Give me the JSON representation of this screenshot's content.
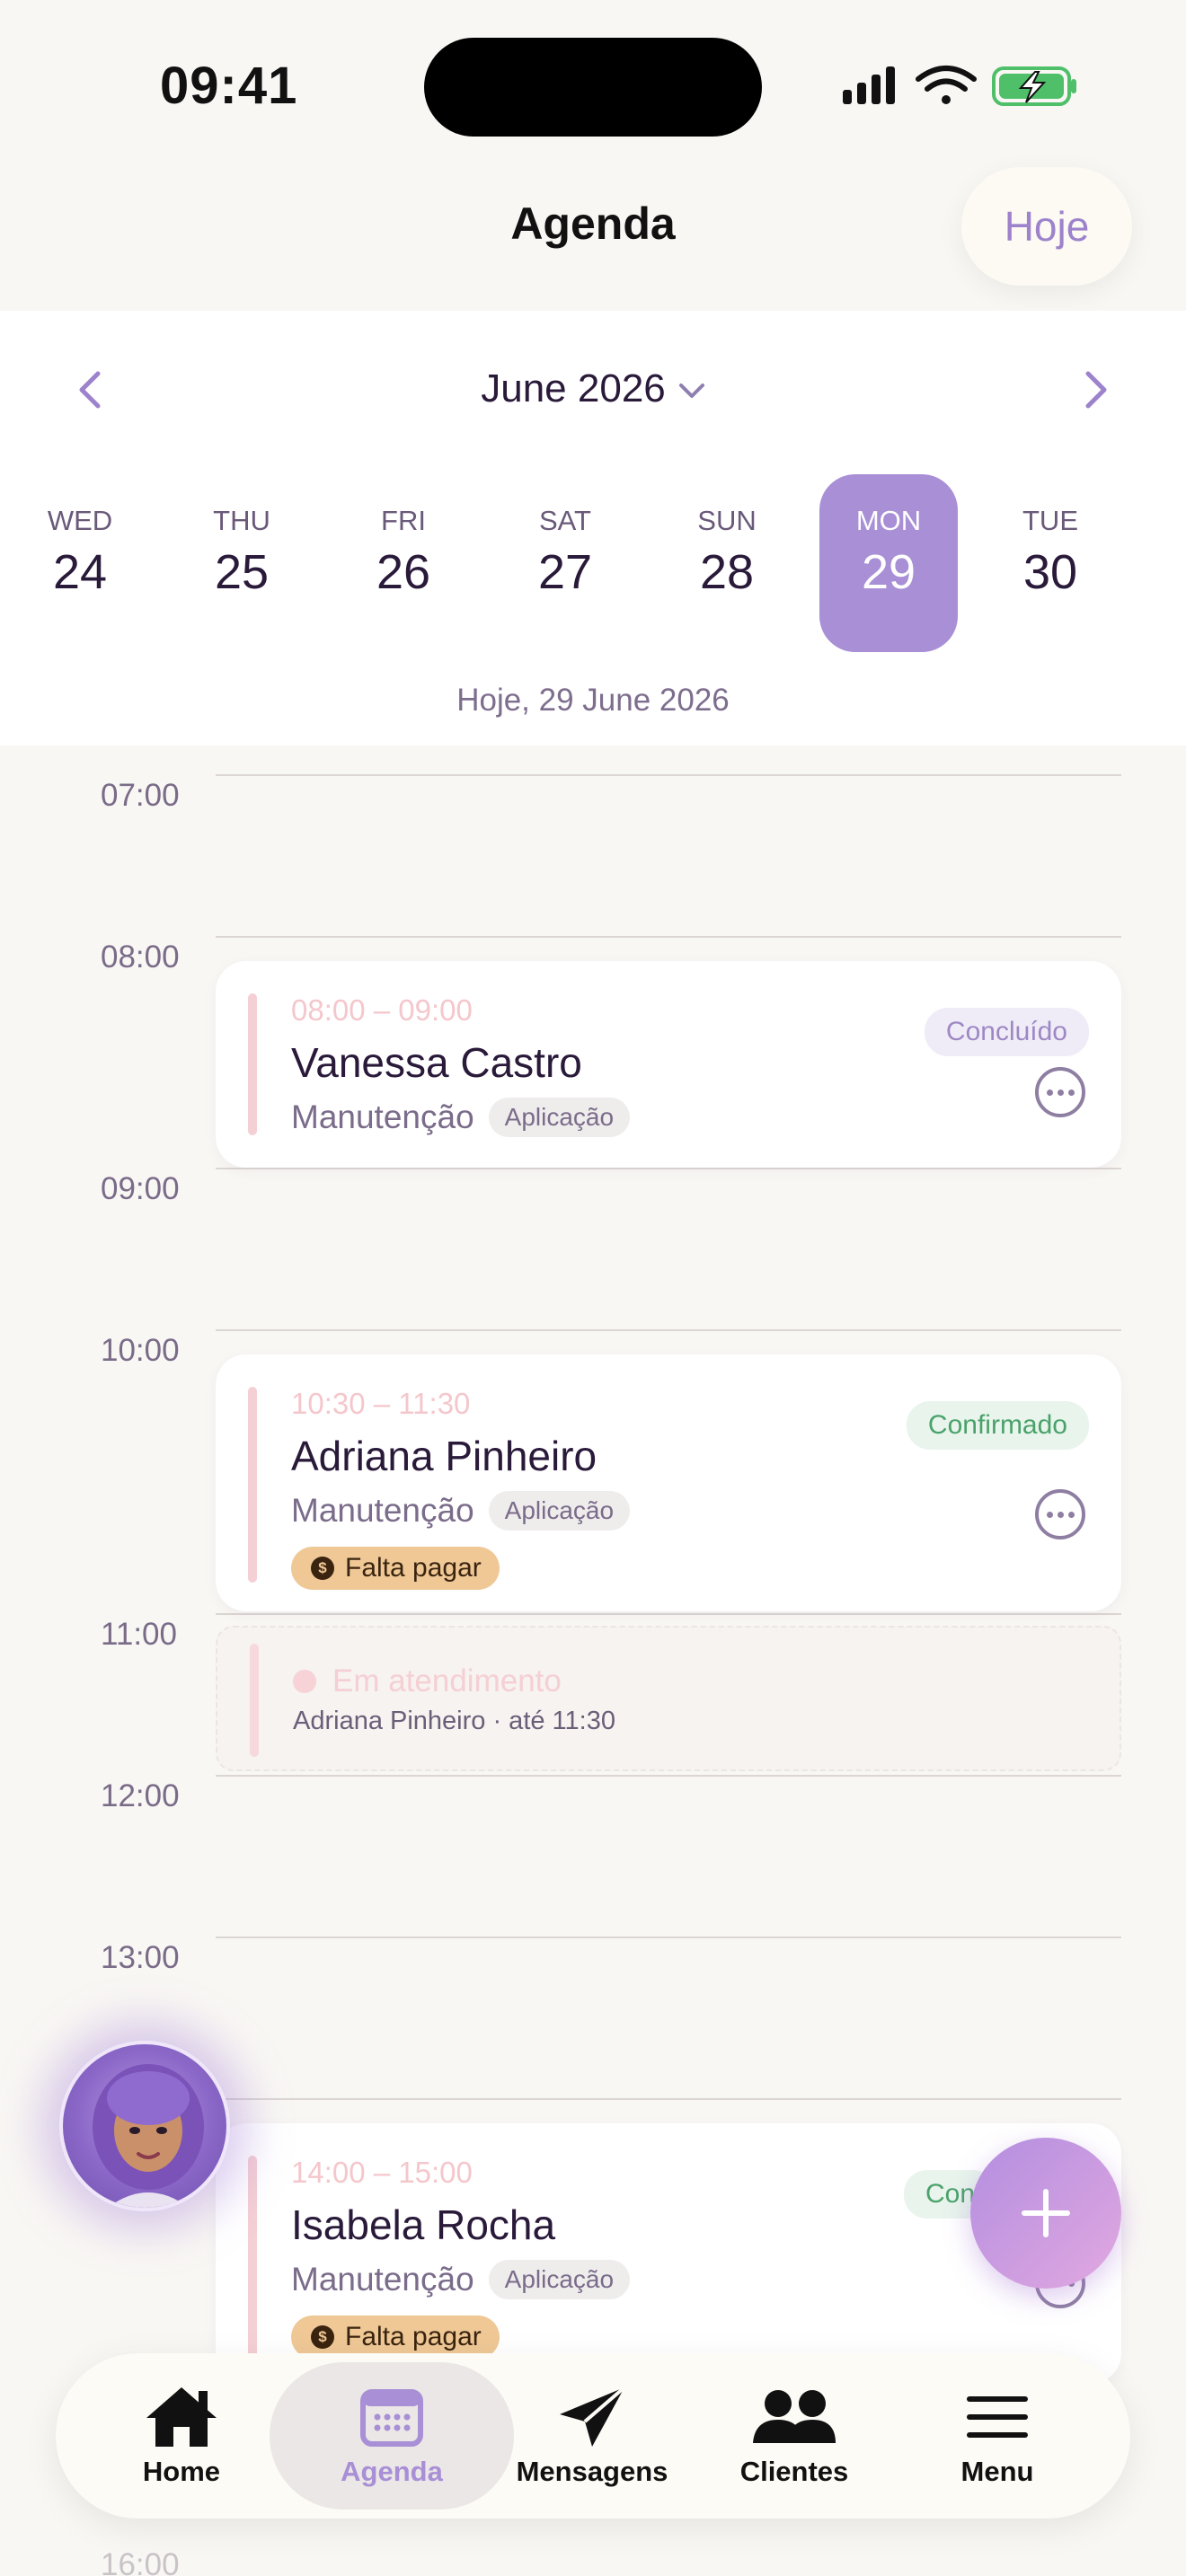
{
  "status_bar": {
    "time": "09:41"
  },
  "header": {
    "title": "Agenda",
    "today_button": "Hoje"
  },
  "calendar": {
    "month_label": "June 2026",
    "days": [
      {
        "dow": "WED",
        "num": "24"
      },
      {
        "dow": "THU",
        "num": "25"
      },
      {
        "dow": "FRI",
        "num": "26"
      },
      {
        "dow": "SAT",
        "num": "27"
      },
      {
        "dow": "SUN",
        "num": "28"
      },
      {
        "dow": "MON",
        "num": "29"
      },
      {
        "dow": "TUE",
        "num": "30"
      }
    ],
    "selected_day": "29",
    "today_caption": "Hoje, 29 June 2026"
  },
  "timeline": {
    "hours": [
      "07:00",
      "08:00",
      "09:00",
      "10:00",
      "11:00",
      "12:00",
      "13:00",
      "16:00"
    ],
    "appointments": [
      {
        "time": "08:00 – 09:00",
        "name": "Vanessa Castro",
        "service": "Manutenção",
        "tag": "Aplicação",
        "status": "Concluído"
      },
      {
        "time": "10:30 – 11:30",
        "name": "Adriana Pinheiro",
        "service": "Manutenção",
        "tag": "Aplicação",
        "status": "Confirmado",
        "payment": "Falta pagar"
      },
      {
        "time": "14:00 – 15:00",
        "name": "Isabela Rocha",
        "service": "Manutenção",
        "tag": "Aplicação",
        "status": "Con",
        "payment": "Falta pagar"
      }
    ],
    "in_progress": {
      "title": "Em atendimento",
      "subtitle": "Adriana Pinheiro · até 11:30"
    }
  },
  "tabbar": {
    "items": [
      {
        "label": "Home",
        "icon": "home-icon"
      },
      {
        "label": "Agenda",
        "icon": "calendar-icon"
      },
      {
        "label": "Mensagens",
        "icon": "send-icon"
      },
      {
        "label": "Clientes",
        "icon": "users-icon"
      },
      {
        "label": "Menu",
        "icon": "menu-icon"
      }
    ],
    "active": "Agenda"
  },
  "colors": {
    "accent": "#a88fd6",
    "background": "#f9f7f4",
    "confirmed": "#4aa26a",
    "payment_pill": "#efc896",
    "appointment_bar": "#f4cfd4"
  }
}
